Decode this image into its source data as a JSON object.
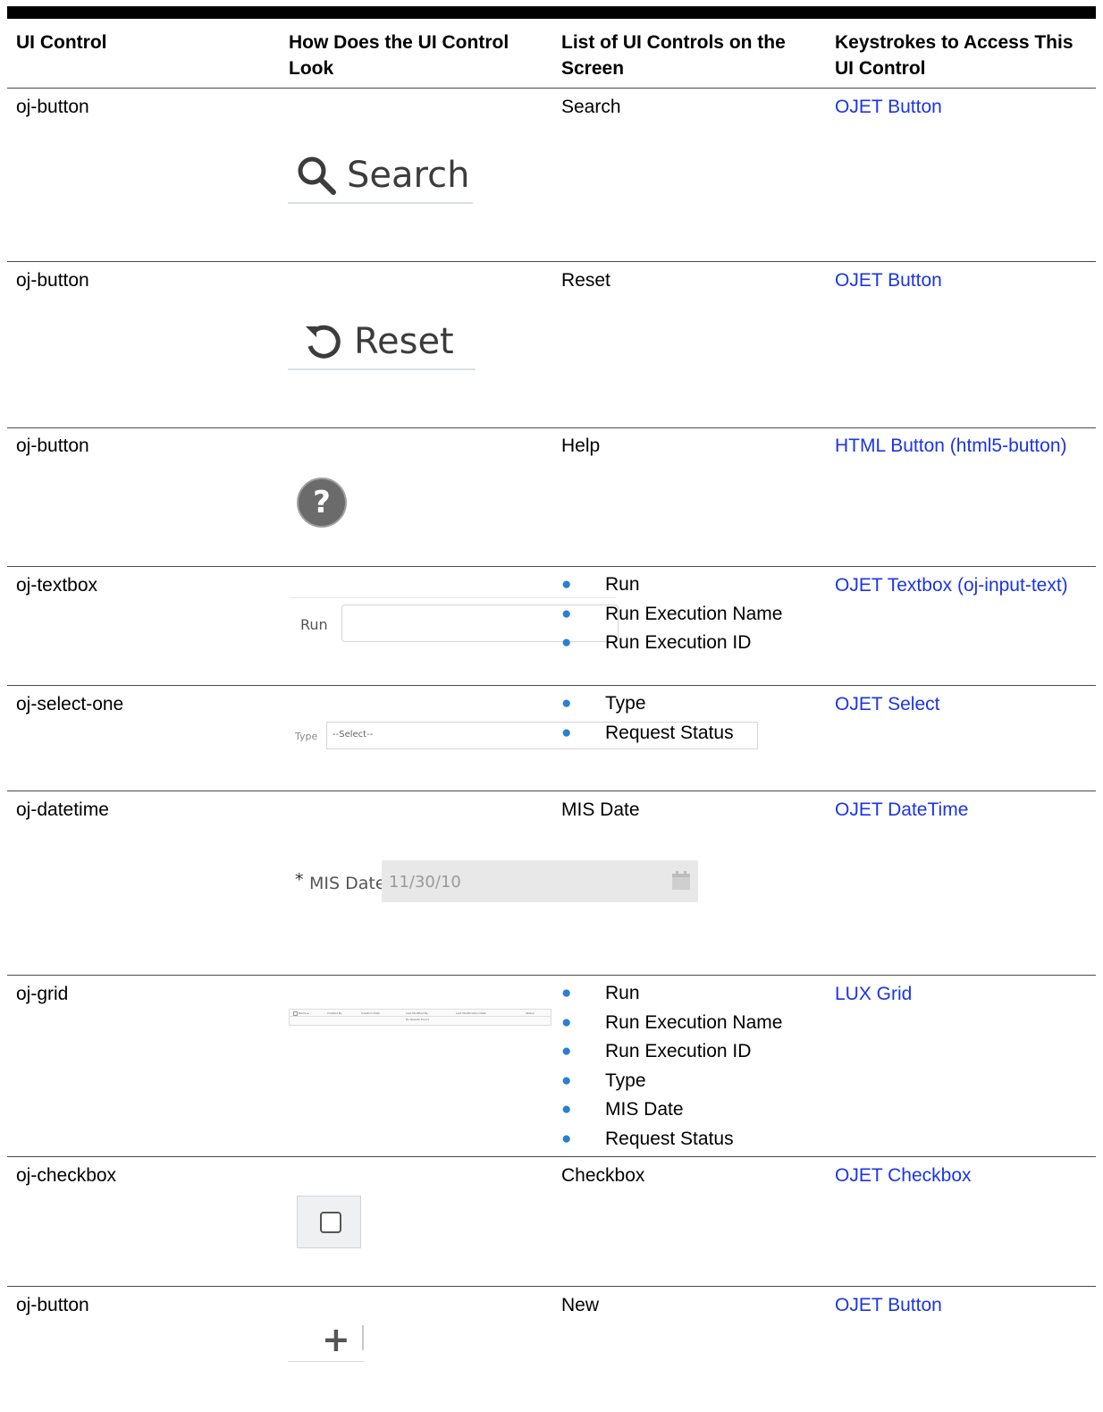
{
  "headers": {
    "col1": "UI Control",
    "col2": "How Does the UI Control Look",
    "col3": "List of UI Controls on the Screen",
    "col4": "Keystrokes to Access This UI Control"
  },
  "rows": [
    {
      "control": "oj-button",
      "preview": {
        "label": "Search",
        "icon": "search-icon"
      },
      "items": [
        "Search"
      ],
      "link": "OJET Button"
    },
    {
      "control": "oj-button",
      "preview": {
        "label": "Reset",
        "icon": "reset-icon"
      },
      "items": [
        "Reset"
      ],
      "link": "OJET Button"
    },
    {
      "control": "oj-button",
      "preview": {
        "glyph": "?",
        "icon": "help-icon"
      },
      "items": [
        "Help"
      ],
      "link": "HTML Button (html5-button)"
    },
    {
      "control": "oj-textbox",
      "preview": {
        "label": "Run"
      },
      "items": [
        "Run",
        "Run Execution Name",
        "Run Execution ID"
      ],
      "link": "OJET Textbox (oj-input-text)"
    },
    {
      "control": "oj-select-one",
      "preview": {
        "label": "Type",
        "value": "--Select--"
      },
      "items": [
        "Type",
        "Request Status"
      ],
      "link": "OJET Select"
    },
    {
      "control": "oj-datetime",
      "preview": {
        "required": "*",
        "label": "MIS Date",
        "value": "11/30/10",
        "icon": "calendar-icon"
      },
      "items": [
        "MIS Date"
      ],
      "link": "OJET DateTime"
    },
    {
      "control": "oj-grid",
      "preview": {
        "columns": [
          "Name ▴",
          "Created By",
          "Creation Date",
          "Last Modified By",
          "Last Modification Date",
          "Status"
        ],
        "empty": "No Results Found"
      },
      "items": [
        "Run",
        "Run Execution Name",
        "Run Execution ID",
        "Type",
        "MIS Date",
        "Request Status"
      ],
      "link": "LUX Grid"
    },
    {
      "control": "oj-checkbox",
      "preview": {
        "icon": "checkbox-icon"
      },
      "items": [
        "Checkbox"
      ],
      "link": "OJET Checkbox"
    },
    {
      "control": "oj-button",
      "preview": {
        "glyph": "+",
        "icon": "plus-icon"
      },
      "items": [
        "New"
      ],
      "link": "OJET Button"
    }
  ],
  "colors": {
    "link": "#1a35e8",
    "bullet": "#2a7fd0",
    "rule": "#4a4a4a"
  }
}
